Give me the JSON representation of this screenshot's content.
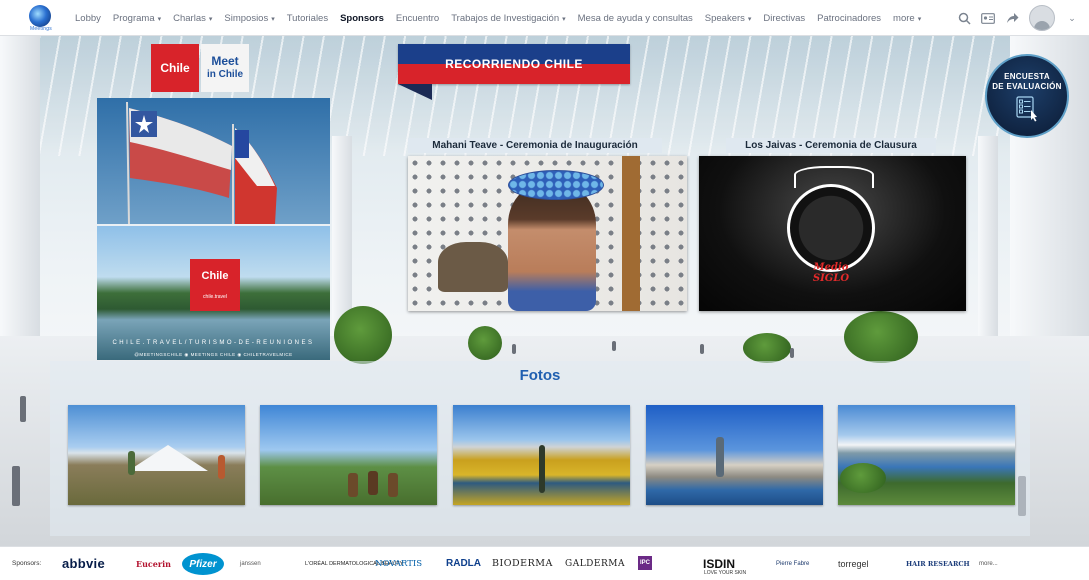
{
  "nav": {
    "logo_caption": "Meetings",
    "items": [
      {
        "label": "Lobby",
        "caret": false,
        "active": false
      },
      {
        "label": "Programa",
        "caret": true,
        "active": false
      },
      {
        "label": "Charlas",
        "caret": true,
        "active": false
      },
      {
        "label": "Simposios",
        "caret": true,
        "active": false
      },
      {
        "label": "Tutoriales",
        "caret": false,
        "active": false
      },
      {
        "label": "Sponsors",
        "caret": false,
        "active": true
      },
      {
        "label": "Encuentro",
        "caret": false,
        "active": false
      },
      {
        "label": "Trabajos de Investigación",
        "caret": true,
        "active": false
      },
      {
        "label": "Mesa de ayuda y consultas",
        "caret": false,
        "active": false
      },
      {
        "label": "Speakers",
        "caret": true,
        "active": false
      },
      {
        "label": "Directivas",
        "caret": false,
        "active": false
      },
      {
        "label": "Patrocinadores",
        "caret": false,
        "active": false
      },
      {
        "label": "more",
        "caret": true,
        "active": false
      }
    ],
    "tools": [
      "search-icon",
      "id-card-icon",
      "share-icon",
      "user-avatar-icon"
    ]
  },
  "banners": {
    "chile_logo": "Chile",
    "meet_line1": "Meet",
    "meet_line2": "in Chile",
    "recorriendo": "RECORRIENDO CHILE"
  },
  "survey": {
    "line1": "ENCUESTA",
    "line2": "DE EVALUACIÓN"
  },
  "travel_panel": {
    "logo": "Chile",
    "logo_sub": "chile.travel",
    "caption": "CHILE.TRAVEL/TURISMO-DE-REUNIONES",
    "social": "@MEETINGSCHILE   ◉ MEETINGS CHILE   ◉ CHILETRAVELMICE"
  },
  "videos": [
    {
      "title": "Mahani Teave - Ceremonia de Inauguración"
    },
    {
      "title": "Los Jaivas - Ceremonia de Clausura",
      "overlay_text": "Medio SIGLO"
    }
  ],
  "fotos": {
    "title": "Fotos",
    "count": 5
  },
  "sponsors": {
    "label": "Sponsors:",
    "logos": [
      "abbvie",
      "Eucerin",
      "Pfizer",
      "janssen",
      "L'ORÉAL DERMATOLOGICAL BEAUTY",
      "NOVARTIS",
      "RADLA",
      "BIODERMA",
      "GALDERMA",
      "IPC",
      "ISDIN",
      "Pierre Fabre",
      "torregel",
      "HAIR RESEARCH"
    ],
    "isdin_sub": "LOVE YOUR SKIN",
    "more": "more..."
  },
  "colors": {
    "accent_blue": "#1f5fb0",
    "chile_red": "#d8232a",
    "nav_active": "#111827"
  }
}
